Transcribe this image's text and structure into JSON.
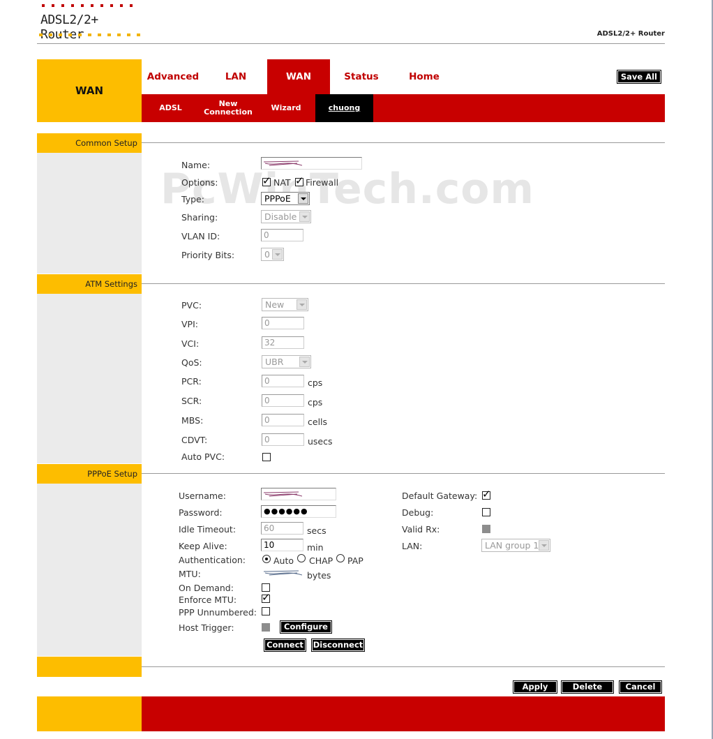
{
  "brand": {
    "logo_text": "ADSL2/2+ Router",
    "right_text": "ADSL2/2+ Router"
  },
  "watermark": "PcWinTech.com",
  "side_title": "WAN",
  "tabs": [
    "Advanced",
    "LAN",
    "WAN",
    "Status",
    "Home"
  ],
  "save_all": "Save All",
  "subtabs": [
    "ADSL",
    "New\nConnection",
    "Wizard",
    "chuong"
  ],
  "common": {
    "heading": "Common Setup",
    "name_label": "Name:",
    "options_label": "Options:",
    "nat_label": "NAT",
    "firewall_label": "Firewall",
    "type_label": "Type:",
    "type_value": "PPPoE",
    "sharing_label": "Sharing:",
    "sharing_value": "Disable",
    "vlan_label": "VLAN ID:",
    "vlan_value": "0",
    "priority_label": "Priority Bits:",
    "priority_value": "0"
  },
  "atm": {
    "heading": "ATM Settings",
    "pvc_label": "PVC:",
    "pvc_value": "New",
    "vpi_label": "VPI:",
    "vpi_value": "0",
    "vci_label": "VCI:",
    "vci_value": "32",
    "qos_label": "QoS:",
    "qos_value": "UBR",
    "pcr_label": "PCR:",
    "pcr_value": "0",
    "pcr_unit": "cps",
    "scr_label": "SCR:",
    "scr_value": "0",
    "scr_unit": "cps",
    "mbs_label": "MBS:",
    "mbs_value": "0",
    "mbs_unit": "cells",
    "cdvt_label": "CDVT:",
    "cdvt_value": "0",
    "cdvt_unit": "usecs",
    "autopvc_label": "Auto PVC:"
  },
  "pppoe": {
    "heading": "PPPoE Setup",
    "username_label": "Username:",
    "password_label": "Password:",
    "password_value": "●●●●●●",
    "idle_label": "Idle Timeout:",
    "idle_value": "60",
    "idle_unit": "secs",
    "keepalive_label": "Keep Alive:",
    "keepalive_value": "10",
    "keepalive_unit": "min",
    "auth_label": "Authentication:",
    "auth_options": [
      "Auto",
      "CHAP",
      "PAP"
    ],
    "mtu_label": "MTU:",
    "mtu_unit": "bytes",
    "ondemand_label": "On Demand:",
    "enforce_label": "Enforce MTU:",
    "unnumbered_label": "PPP Unnumbered:",
    "hosttrigger_label": "Host Trigger:",
    "configure_label": "Configure",
    "connect_label": "Connect",
    "disconnect_label": "Disconnect",
    "gateway_label": "Default Gateway:",
    "debug_label": "Debug:",
    "validrx_label": "Valid Rx:",
    "lan_label": "LAN:",
    "lan_value": "LAN group 1"
  },
  "actions": {
    "apply": "Apply",
    "delete": "Delete",
    "cancel": "Cancel"
  },
  "colors": {
    "brand_red": "#c80000",
    "brand_yellow": "#fdbd00",
    "section_gray": "#ebebeb"
  }
}
